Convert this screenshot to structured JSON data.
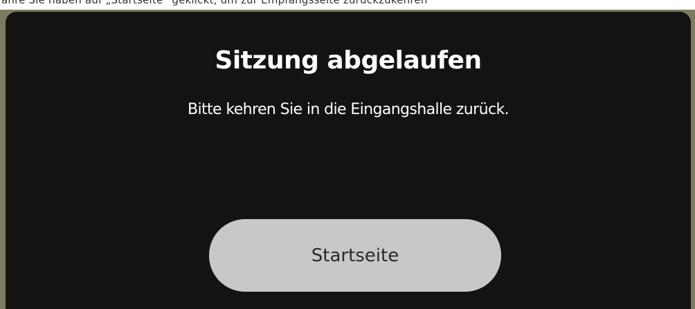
{
  "header": {
    "partial_text": "ahre Sie haben auf „Startseite“ geklickt, um zur Empfangsseite zurückzukehren"
  },
  "dialog": {
    "title": "Sitzung abgelaufen",
    "message": "Bitte kehren Sie in die Eingangshalle zurück.",
    "home_button_label": "Startseite"
  },
  "colors": {
    "dialog_background": "#131313",
    "backdrop": "#7d7b5f",
    "button_background": "#c8c8c8",
    "text_primary": "#ffffff"
  }
}
